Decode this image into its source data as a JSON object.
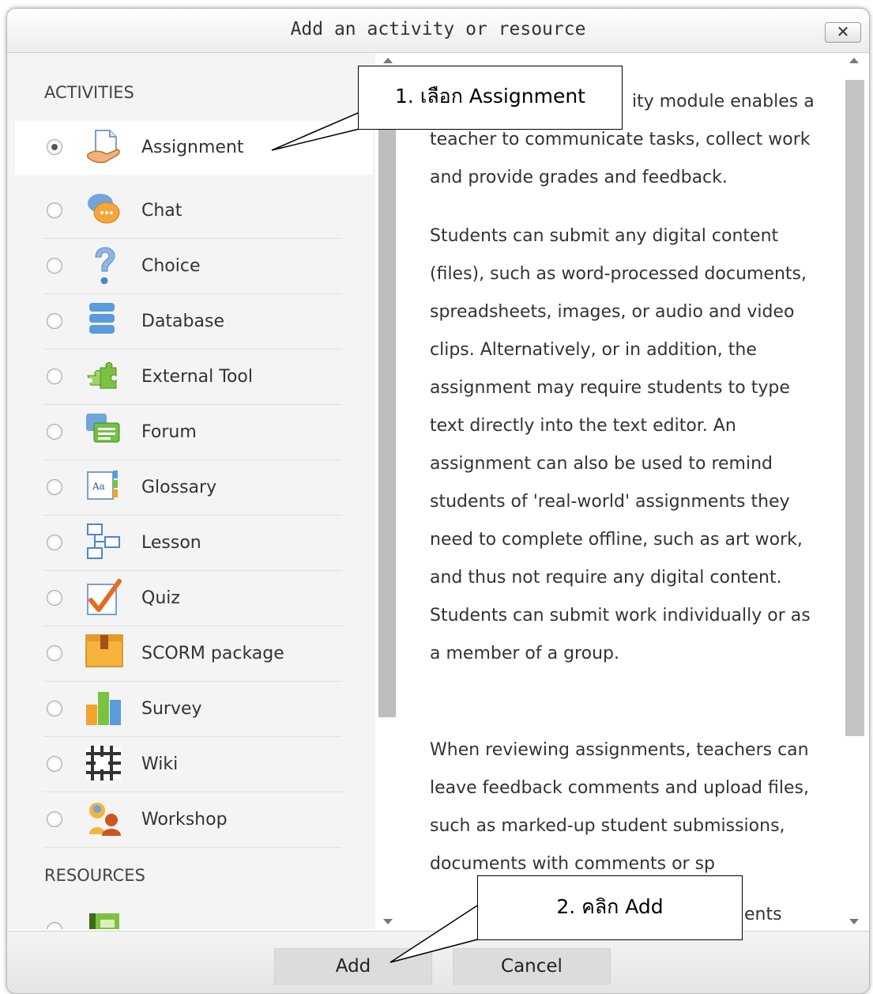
{
  "dialog": {
    "title": "Add an activity or resource",
    "close_label": "✕",
    "activities_label": "ACTIVITIES",
    "resources_label": "RESOURCES",
    "activities": [
      {
        "label": "Assignment",
        "icon": "assignment-icon",
        "selected": true
      },
      {
        "label": "Chat",
        "icon": "chat-icon",
        "selected": false
      },
      {
        "label": "Choice",
        "icon": "choice-icon",
        "selected": false
      },
      {
        "label": "Database",
        "icon": "database-icon",
        "selected": false
      },
      {
        "label": "External Tool",
        "icon": "external-tool-icon",
        "selected": false
      },
      {
        "label": "Forum",
        "icon": "forum-icon",
        "selected": false
      },
      {
        "label": "Glossary",
        "icon": "glossary-icon",
        "selected": false
      },
      {
        "label": "Lesson",
        "icon": "lesson-icon",
        "selected": false
      },
      {
        "label": "Quiz",
        "icon": "quiz-icon",
        "selected": false
      },
      {
        "label": "SCORM package",
        "icon": "scorm-package-icon",
        "selected": false
      },
      {
        "label": "Survey",
        "icon": "survey-icon",
        "selected": false
      },
      {
        "label": "Wiki",
        "icon": "wiki-icon",
        "selected": false
      },
      {
        "label": "Workshop",
        "icon": "workshop-icon",
        "selected": false
      }
    ],
    "description": {
      "p1": "ity module enables a teacher to communicate tasks, collect work and provide grades and feedback.",
      "p2": "Students can submit any digital content (files), such as word-processed documents, spreadsheets, images, or audio and video clips. Alternatively, or in addition, the assignment may require students to type text directly into the text editor. An assignment can also be used to remind students of 'real-world' assignments they need to complete offline, such as art work, and thus not require any digital content. Students can submit work individually or as a member of a group.",
      "p3": "When reviewing assignments, teachers can leave feedback comments and upload files, such as marked-up student submissions, documents with comments or sp",
      "p3_tail": "ents"
    },
    "add_label": "Add",
    "cancel_label": "Cancel"
  },
  "annotations": {
    "step1": "1. เลือก Assignment",
    "step2": "2. คลิก Add"
  }
}
